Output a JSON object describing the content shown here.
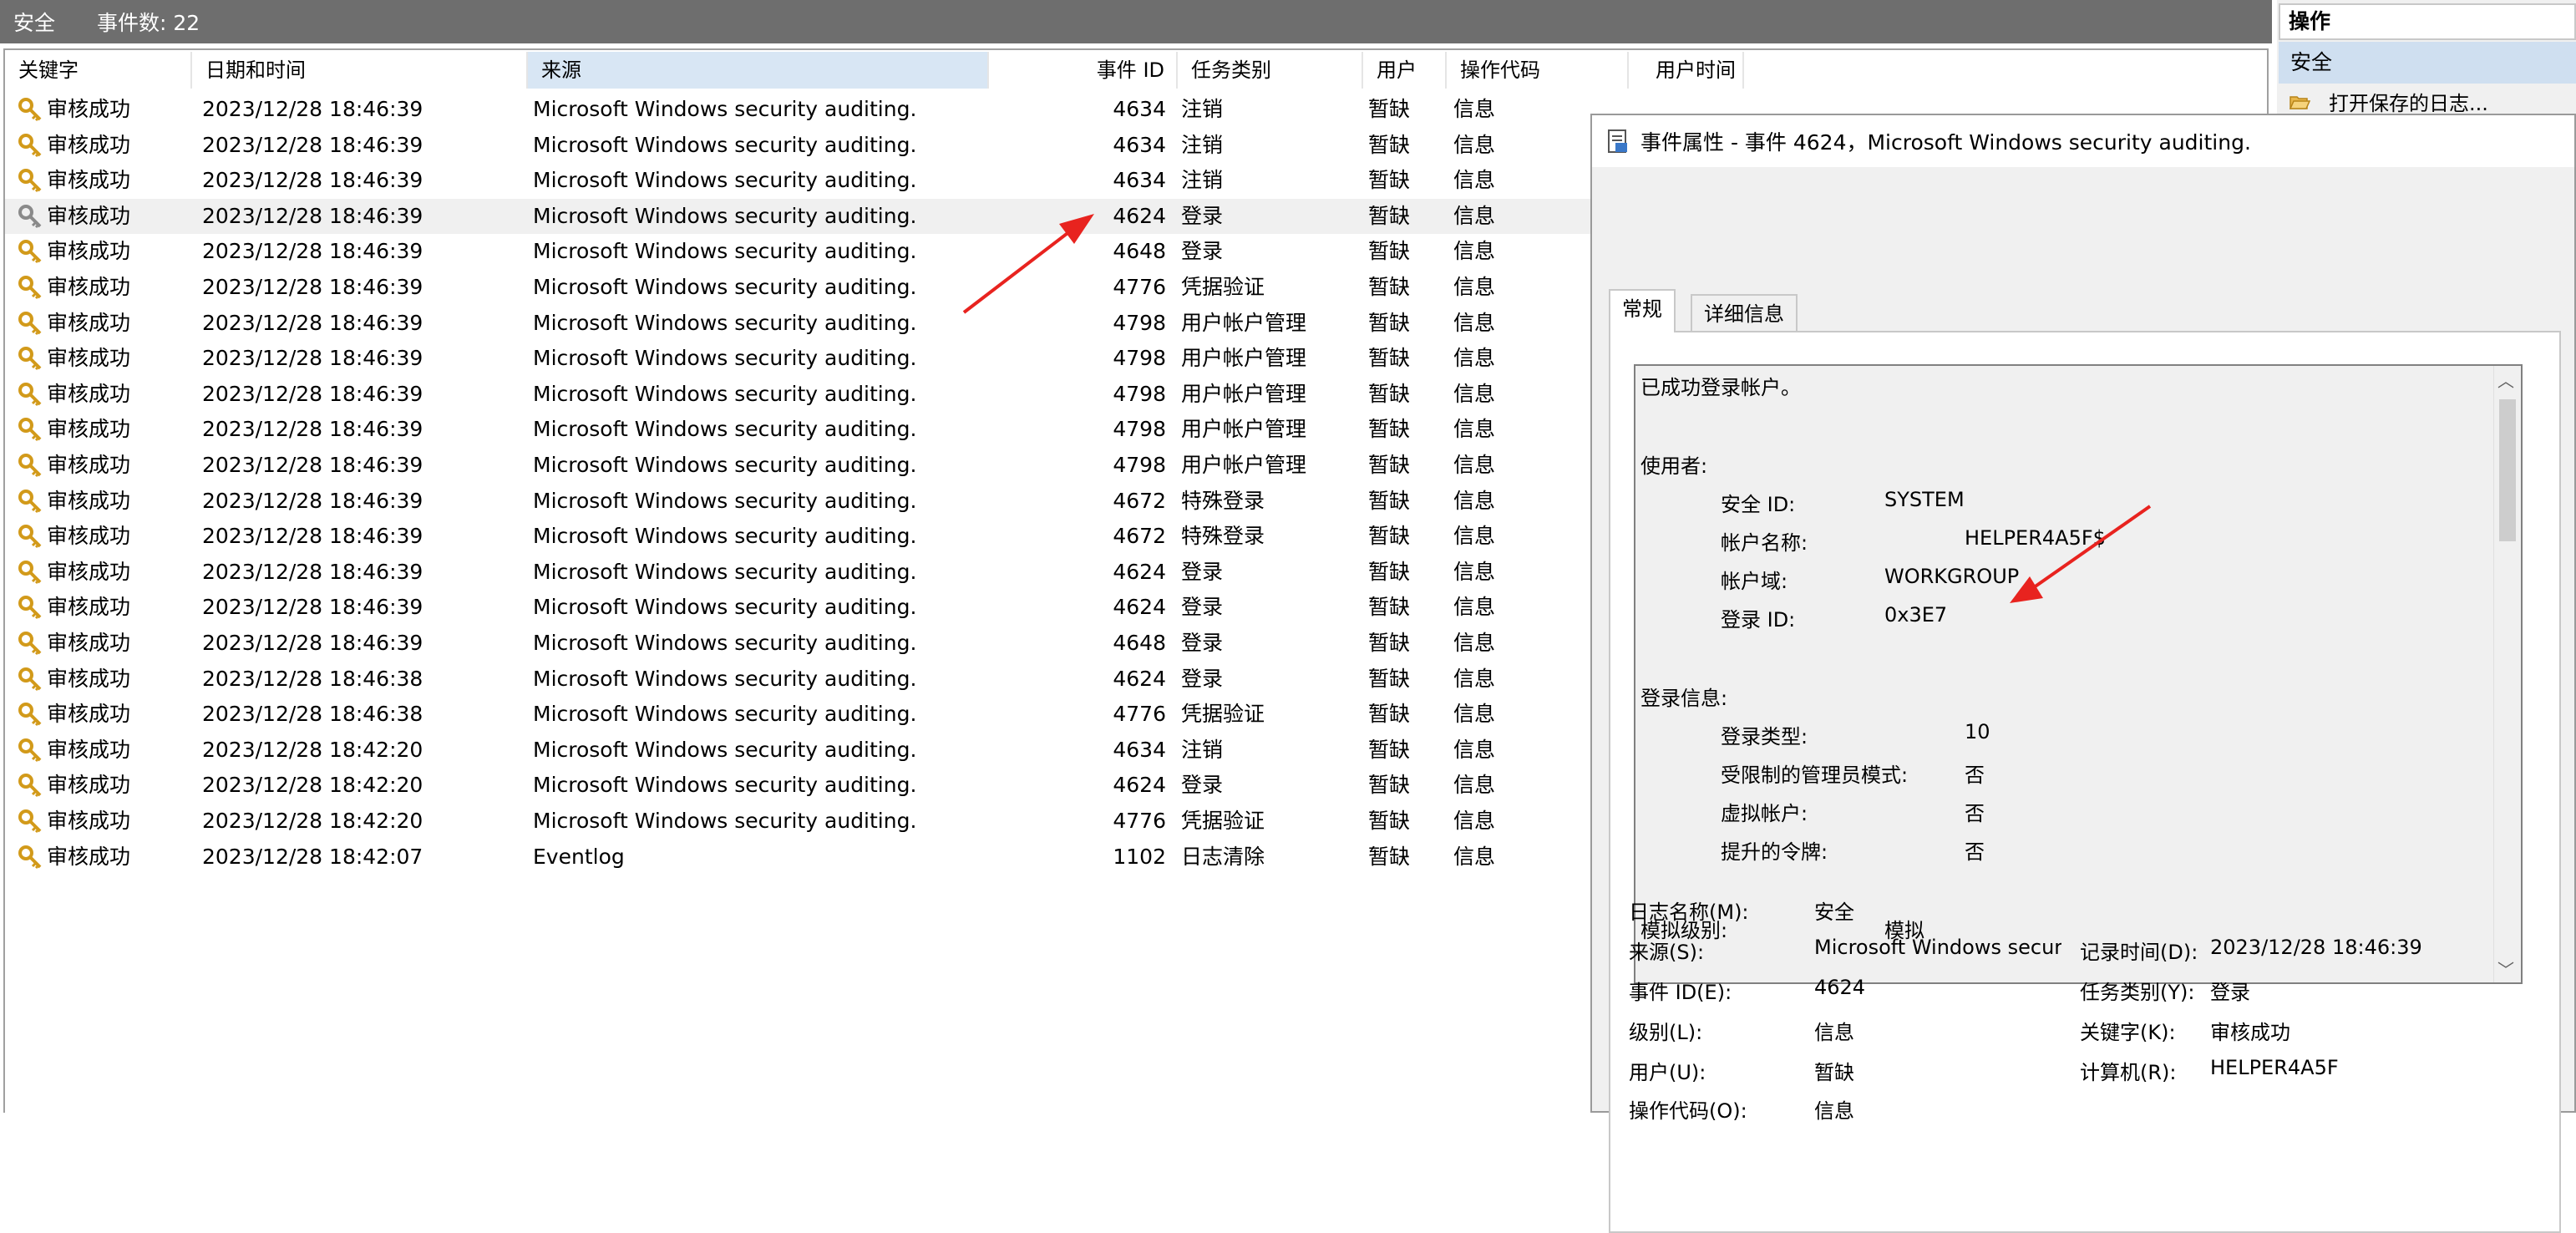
{
  "titlebar": {
    "log": "安全",
    "count_label": "事件数: 22"
  },
  "columns": {
    "keyword": "关键字",
    "datetime": "日期和时间",
    "source": "来源",
    "event_id": "事件 ID",
    "task": "任务类别",
    "user": "用户",
    "opcode": "操作代码",
    "user_time": "用户时间"
  },
  "rows": [
    {
      "keyword": "审核成功",
      "datetime": "2023/12/28 18:46:39",
      "source": "Microsoft Windows security auditing.",
      "event_id": "4634",
      "task": "注销",
      "user": "暂缺",
      "opcode": "信息"
    },
    {
      "keyword": "审核成功",
      "datetime": "2023/12/28 18:46:39",
      "source": "Microsoft Windows security auditing.",
      "event_id": "4634",
      "task": "注销",
      "user": "暂缺",
      "opcode": "信息"
    },
    {
      "keyword": "审核成功",
      "datetime": "2023/12/28 18:46:39",
      "source": "Microsoft Windows security auditing.",
      "event_id": "4634",
      "task": "注销",
      "user": "暂缺",
      "opcode": "信息"
    },
    {
      "keyword": "审核成功",
      "datetime": "2023/12/28 18:46:39",
      "source": "Microsoft Windows security auditing.",
      "event_id": "4624",
      "task": "登录",
      "user": "暂缺",
      "opcode": "信息",
      "selected": true
    },
    {
      "keyword": "审核成功",
      "datetime": "2023/12/28 18:46:39",
      "source": "Microsoft Windows security auditing.",
      "event_id": "4648",
      "task": "登录",
      "user": "暂缺",
      "opcode": "信息"
    },
    {
      "keyword": "审核成功",
      "datetime": "2023/12/28 18:46:39",
      "source": "Microsoft Windows security auditing.",
      "event_id": "4776",
      "task": "凭据验证",
      "user": "暂缺",
      "opcode": "信息"
    },
    {
      "keyword": "审核成功",
      "datetime": "2023/12/28 18:46:39",
      "source": "Microsoft Windows security auditing.",
      "event_id": "4798",
      "task": "用户帐户管理",
      "user": "暂缺",
      "opcode": "信息"
    },
    {
      "keyword": "审核成功",
      "datetime": "2023/12/28 18:46:39",
      "source": "Microsoft Windows security auditing.",
      "event_id": "4798",
      "task": "用户帐户管理",
      "user": "暂缺",
      "opcode": "信息"
    },
    {
      "keyword": "审核成功",
      "datetime": "2023/12/28 18:46:39",
      "source": "Microsoft Windows security auditing.",
      "event_id": "4798",
      "task": "用户帐户管理",
      "user": "暂缺",
      "opcode": "信息"
    },
    {
      "keyword": "审核成功",
      "datetime": "2023/12/28 18:46:39",
      "source": "Microsoft Windows security auditing.",
      "event_id": "4798",
      "task": "用户帐户管理",
      "user": "暂缺",
      "opcode": "信息"
    },
    {
      "keyword": "审核成功",
      "datetime": "2023/12/28 18:46:39",
      "source": "Microsoft Windows security auditing.",
      "event_id": "4798",
      "task": "用户帐户管理",
      "user": "暂缺",
      "opcode": "信息"
    },
    {
      "keyword": "审核成功",
      "datetime": "2023/12/28 18:46:39",
      "source": "Microsoft Windows security auditing.",
      "event_id": "4672",
      "task": "特殊登录",
      "user": "暂缺",
      "opcode": "信息"
    },
    {
      "keyword": "审核成功",
      "datetime": "2023/12/28 18:46:39",
      "source": "Microsoft Windows security auditing.",
      "event_id": "4672",
      "task": "特殊登录",
      "user": "暂缺",
      "opcode": "信息"
    },
    {
      "keyword": "审核成功",
      "datetime": "2023/12/28 18:46:39",
      "source": "Microsoft Windows security auditing.",
      "event_id": "4624",
      "task": "登录",
      "user": "暂缺",
      "opcode": "信息"
    },
    {
      "keyword": "审核成功",
      "datetime": "2023/12/28 18:46:39",
      "source": "Microsoft Windows security auditing.",
      "event_id": "4624",
      "task": "登录",
      "user": "暂缺",
      "opcode": "信息"
    },
    {
      "keyword": "审核成功",
      "datetime": "2023/12/28 18:46:39",
      "source": "Microsoft Windows security auditing.",
      "event_id": "4648",
      "task": "登录",
      "user": "暂缺",
      "opcode": "信息"
    },
    {
      "keyword": "审核成功",
      "datetime": "2023/12/28 18:46:38",
      "source": "Microsoft Windows security auditing.",
      "event_id": "4624",
      "task": "登录",
      "user": "暂缺",
      "opcode": "信息"
    },
    {
      "keyword": "审核成功",
      "datetime": "2023/12/28 18:46:38",
      "source": "Microsoft Windows security auditing.",
      "event_id": "4776",
      "task": "凭据验证",
      "user": "暂缺",
      "opcode": "信息"
    },
    {
      "keyword": "审核成功",
      "datetime": "2023/12/28 18:42:20",
      "source": "Microsoft Windows security auditing.",
      "event_id": "4634",
      "task": "注销",
      "user": "暂缺",
      "opcode": "信息"
    },
    {
      "keyword": "审核成功",
      "datetime": "2023/12/28 18:42:20",
      "source": "Microsoft Windows security auditing.",
      "event_id": "4624",
      "task": "登录",
      "user": "暂缺",
      "opcode": "信息"
    },
    {
      "keyword": "审核成功",
      "datetime": "2023/12/28 18:42:20",
      "source": "Microsoft Windows security auditing.",
      "event_id": "4776",
      "task": "凭据验证",
      "user": "暂缺",
      "opcode": "信息"
    },
    {
      "keyword": "审核成功",
      "datetime": "2023/12/28 18:42:07",
      "source": "Eventlog",
      "event_id": "1102",
      "task": "日志清除",
      "user": "暂缺",
      "opcode": "信息"
    }
  ],
  "actions": {
    "header": "操作",
    "section": "安全",
    "open_saved": "打开保存的日志..."
  },
  "dialog": {
    "title": "事件属性 - 事件 4624，Microsoft Windows security auditing.",
    "tab_general": "常规",
    "tab_details": "详细信息",
    "message": {
      "line1": "已成功登录帐户。",
      "subject_label": "使用者:",
      "security_id_label": "安全 ID:",
      "security_id_value": "SYSTEM",
      "account_name_label": "帐户名称:",
      "account_name_value": "HELPER4A5F$",
      "account_domain_label": "帐户域:",
      "account_domain_value": "WORKGROUP",
      "logon_id_label": "登录 ID:",
      "logon_id_value": "0x3E7",
      "logon_info_label": "登录信息:",
      "logon_type_label": "登录类型:",
      "logon_type_value": "10",
      "restricted_admin_label": "受限制的管理员模式:",
      "restricted_admin_value": "否",
      "virtual_account_label": "虚拟帐户:",
      "virtual_account_value": "否",
      "elevated_token_label": "提升的令牌:",
      "elevated_token_value": "否",
      "impersonation_label": "模拟级别:",
      "impersonation_value": "模拟"
    },
    "fields": {
      "log_name_label": "日志名称(M):",
      "log_name_value": "安全",
      "source_label": "来源(S):",
      "source_value": "Microsoft Windows securi",
      "logged_label": "记录时间(D):",
      "logged_value": "2023/12/28 18:46:39",
      "event_id_label": "事件 ID(E):",
      "event_id_value": "4624",
      "task_label": "任务类别(Y):",
      "task_value": "登录",
      "level_label": "级别(L):",
      "level_value": "信息",
      "keywords_label": "关键字(K):",
      "keywords_value": "审核成功",
      "user_label": "用户(U):",
      "user_value": "暂缺",
      "computer_label": "计算机(R):",
      "computer_value": "HELPER4A5F",
      "opcode_label": "操作代码(O):",
      "opcode_value": "信息"
    }
  },
  "colors": {
    "arrow": "#e8231f",
    "selected_row": "#f0f0f0",
    "sorted_column": "#d8e6f4",
    "titlebar": "#6e6e6e"
  }
}
